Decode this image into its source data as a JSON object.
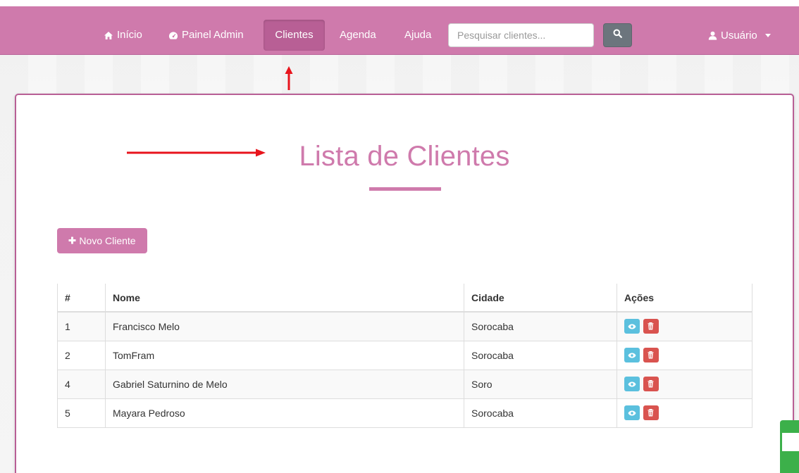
{
  "navbar": {
    "items": [
      {
        "label": "Início",
        "icon": "home-icon"
      },
      {
        "label": "Painel Admin",
        "icon": "dashboard-icon"
      },
      {
        "label": "Clientes",
        "active": true
      },
      {
        "label": "Agenda"
      },
      {
        "label": "Ajuda"
      }
    ],
    "search_placeholder": "Pesquisar clientes...",
    "search_icon": "search-icon",
    "user_label": "Usuário",
    "user_icon": "user-icon"
  },
  "main": {
    "title": "Lista de Clientes",
    "new_button_label": "Novo Cliente",
    "table": {
      "headers": [
        "#",
        "Nome",
        "Cidade",
        "Ações"
      ],
      "rows": [
        {
          "id": "1",
          "nome": "Francisco Melo",
          "cidade": "Sorocaba"
        },
        {
          "id": "2",
          "nome": "TomFram",
          "cidade": "Sorocaba"
        },
        {
          "id": "4",
          "nome": "Gabriel Saturnino de Melo",
          "cidade": "Soro"
        },
        {
          "id": "5",
          "nome": "Mayara Pedroso",
          "cidade": "Sorocaba"
        }
      ],
      "actions": [
        "view-icon",
        "trash-icon"
      ]
    }
  },
  "colors": {
    "brand": "#cf7aac",
    "brand_dark": "#b85f95",
    "view": "#5bc0de",
    "delete": "#d9534f",
    "search_button": "#6c757d",
    "annotation_arrow": "#e8141c"
  }
}
